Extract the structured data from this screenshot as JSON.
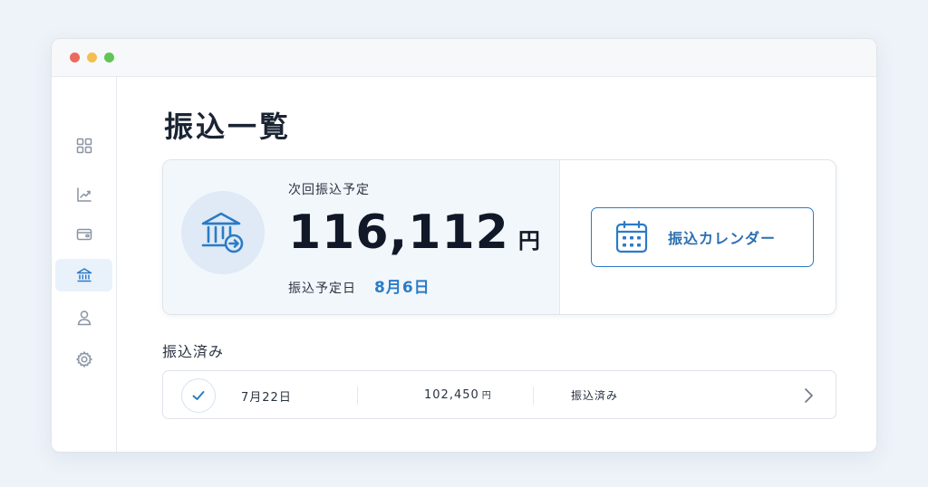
{
  "window": {
    "controls": [
      "close",
      "minimize",
      "zoom"
    ]
  },
  "sidebar": {
    "items": [
      {
        "icon": "dashboard-icon",
        "active": false
      },
      {
        "icon": "chart-icon",
        "active": false
      },
      {
        "icon": "wallet-icon",
        "active": false
      },
      {
        "icon": "bank-icon",
        "active": true
      },
      {
        "icon": "user-icon",
        "active": false
      },
      {
        "icon": "gear-icon",
        "active": false
      }
    ]
  },
  "page": {
    "title": "振込一覧"
  },
  "summary": {
    "label": "次回振込予定",
    "amount": "116,112",
    "unit": "円",
    "date_label": "振込予定日",
    "date_value": "8月6日",
    "icon": "bank-transfer-icon"
  },
  "calendar_button": {
    "label": "振込カレンダー",
    "icon": "calendar-icon"
  },
  "completed": {
    "title": "振込済み",
    "rows": [
      {
        "date": "7月22日",
        "amount": "102,450",
        "unit": "円",
        "status": "振込済み"
      }
    ]
  },
  "colors": {
    "accent": "#2b7bc6",
    "background": "#eef3f9",
    "active_nav": "#e9f2fb"
  }
}
